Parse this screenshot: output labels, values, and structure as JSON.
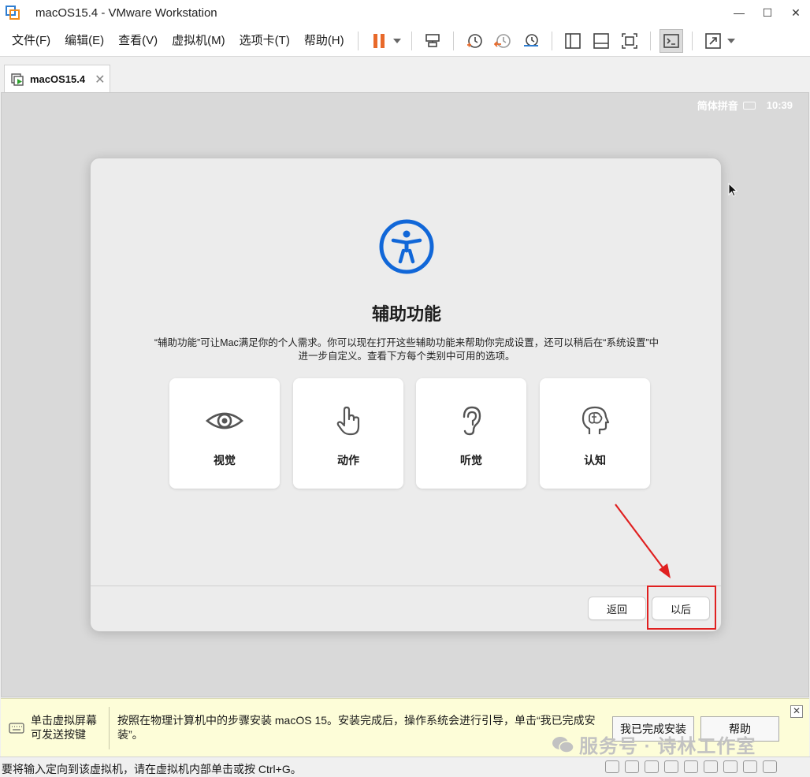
{
  "window": {
    "title": "macOS15.4 - VMware Workstation",
    "controls": [
      "—",
      "☐",
      "✕"
    ]
  },
  "menu": {
    "items": [
      "文件(F)",
      "编辑(E)",
      "查看(V)",
      "虚拟机(M)",
      "选项卡(T)",
      "帮助(H)"
    ]
  },
  "toolbar": {
    "icons": [
      "pause-icon",
      "dropdown-icon",
      "send-keys-icon",
      "snapshot-icon",
      "revert-snapshot-icon",
      "snapshot-manager-icon",
      "library-icon",
      "thumbnail-icon",
      "fit-guest-icon",
      "console-view-icon",
      "fullscreen-icon",
      "dropdown-icon"
    ],
    "accent": "#e8692a"
  },
  "tab": {
    "label": "macOS15.4",
    "close": "✕"
  },
  "guest": {
    "input_method": "简体拼音",
    "clock": "10:39",
    "dialog": {
      "title": "辅助功能",
      "description": "“辅助功能”可让Mac满足你的个人需求。你可以现在打开这些辅助功能来帮助你完成设置，还可以稍后在“系统设置”中进一步自定义。查看下方每个类别中可用的选项。",
      "cards": [
        {
          "label": "视觉",
          "icon": "eye-icon"
        },
        {
          "label": "动作",
          "icon": "hand-pointer-icon"
        },
        {
          "label": "听觉",
          "icon": "ear-icon"
        },
        {
          "label": "认知",
          "icon": "head-brain-icon"
        }
      ],
      "back_label": "返回",
      "later_label": "以后",
      "accent": "#1167d8"
    }
  },
  "notification": {
    "hint": "单击虚拟屏幕可发送按键",
    "message": "按照在物理计算机中的步骤安装 macOS 15。安装完成后，操作系统会进行引导，单击“我已完成安装”。",
    "done_label": "我已完成安装",
    "help_label": "帮助",
    "close": "✕",
    "watermark": "服务号 · 诗林工作室"
  },
  "status": {
    "text": "要将输入定向到该虚拟机，请在虚拟机内部单击或按 Ctrl+G。"
  },
  "annotation_color": "#e02020"
}
